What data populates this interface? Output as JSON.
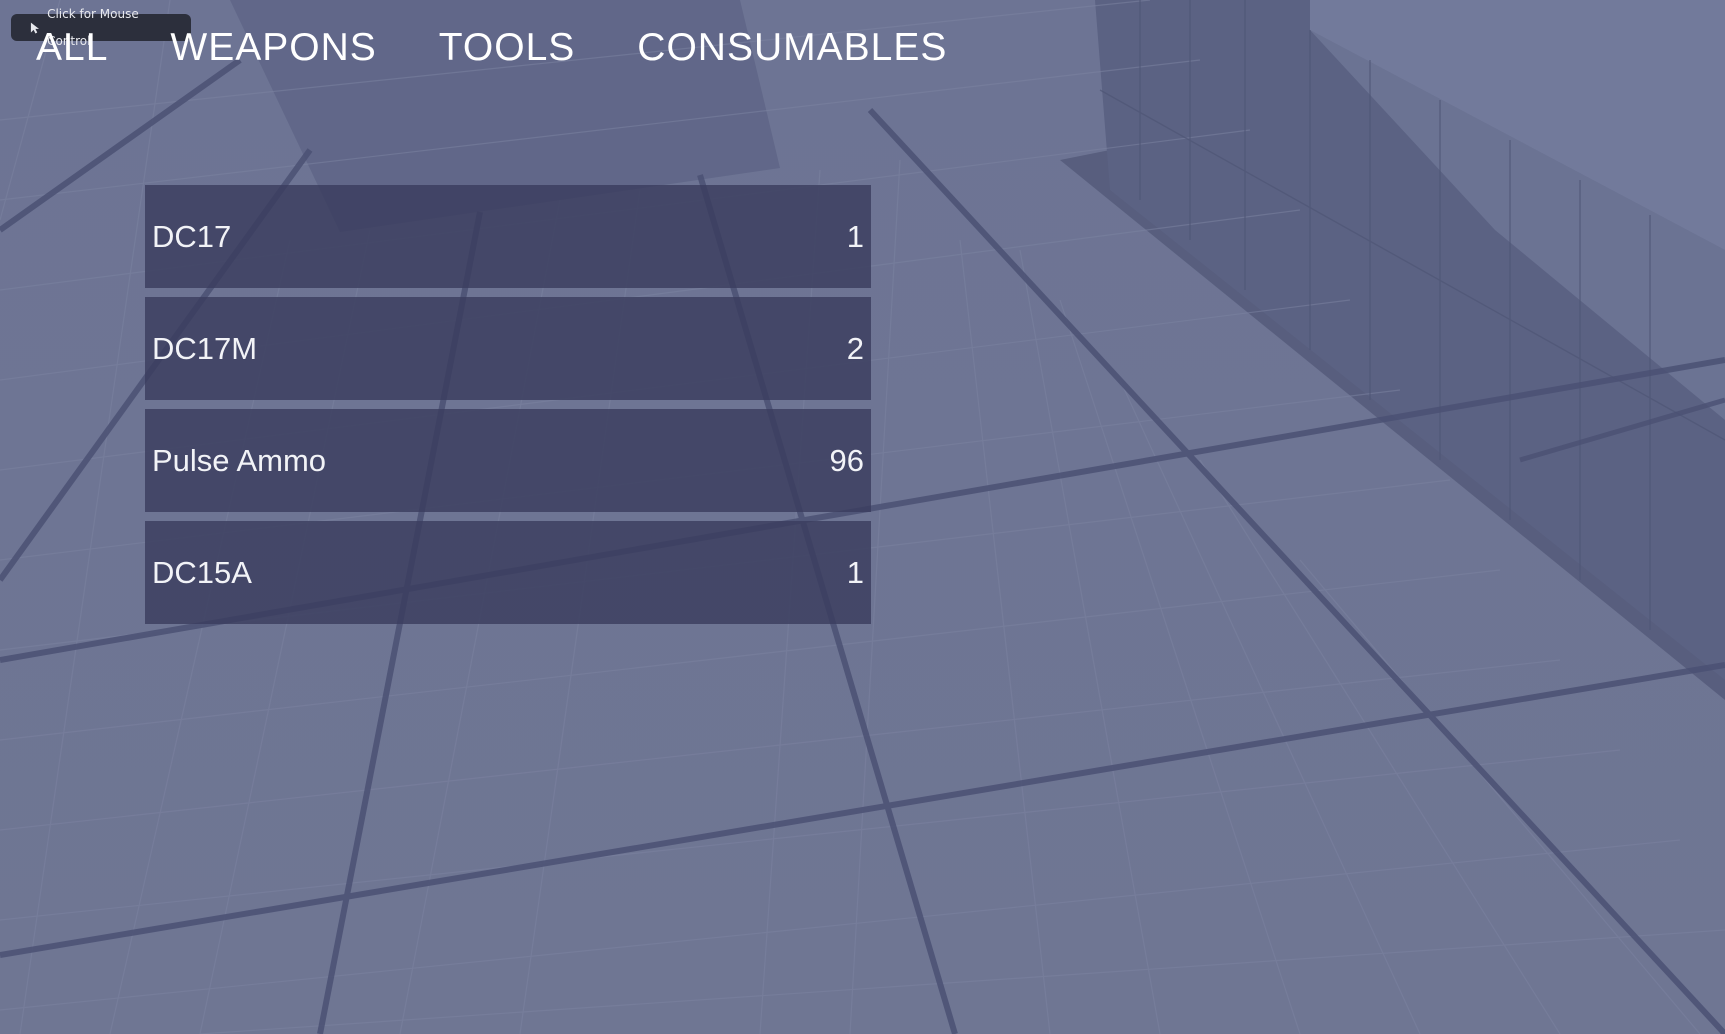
{
  "mouse_hint": {
    "label": "Click for Mouse Control",
    "icon": "cursor-arrow-icon"
  },
  "tabs": [
    {
      "label": "ALL"
    },
    {
      "label": "WEAPONS"
    },
    {
      "label": "TOOLS"
    },
    {
      "label": "CONSUMABLES"
    }
  ],
  "inventory": [
    {
      "name": "DC17",
      "quantity": "1"
    },
    {
      "name": "DC17M",
      "quantity": "2"
    },
    {
      "name": "Pulse Ammo",
      "quantity": "96"
    },
    {
      "name": "DC15A",
      "quantity": "1"
    }
  ],
  "colors": {
    "floor": "#6a7190",
    "panel": "#3a3d5e",
    "text": "#ffffff",
    "hint_bg": "#2c2f3c"
  }
}
